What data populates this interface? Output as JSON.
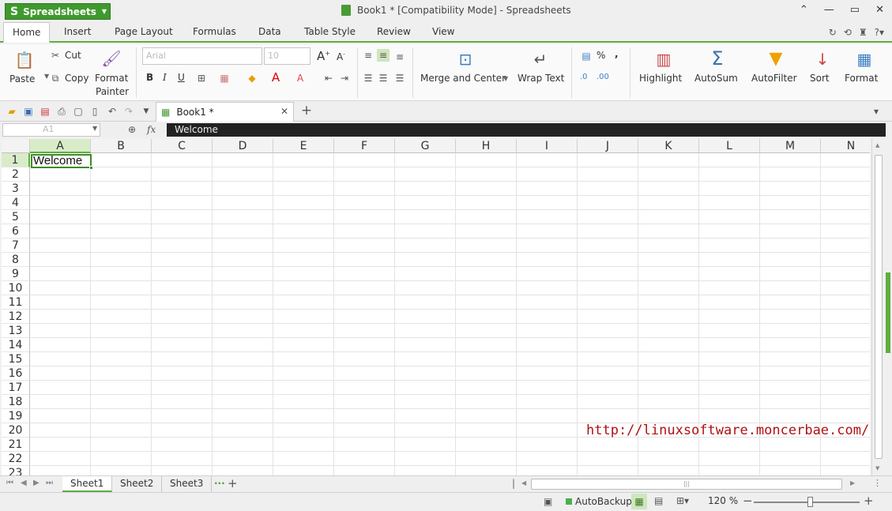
{
  "app": {
    "name": "Spreadsheets",
    "window_title": "Book1 * [Compatibility Mode] - Spreadsheets"
  },
  "menu": {
    "items": [
      "Home",
      "Insert",
      "Page Layout",
      "Formulas",
      "Data",
      "Table Style",
      "Review",
      "View"
    ],
    "active": "Home"
  },
  "ribbon": {
    "paste": "Paste",
    "cut": "Cut",
    "copy": "Copy",
    "format_painter_1": "Format",
    "format_painter_2": "Painter",
    "merge_center": "Merge and Center",
    "wrap_text": "Wrap Text",
    "percent": "%",
    "comma": ",",
    "highlight": "Highlight",
    "autosum": "AutoSum",
    "autofilter": "AutoFilter",
    "sort": "Sort",
    "format": "Format",
    "bold": "B",
    "italic": "I",
    "underline": "U",
    "font_name": "Arial",
    "font_size": "10"
  },
  "doc_tab": {
    "label": "Book1 *"
  },
  "formula_bar": {
    "name_box": "A1",
    "fx": "fx",
    "content": "Welcome"
  },
  "grid": {
    "columns": [
      "A",
      "B",
      "C",
      "D",
      "E",
      "F",
      "G",
      "H",
      "I",
      "J",
      "K",
      "L",
      "M",
      "N"
    ],
    "rows": [
      "1",
      "2",
      "3",
      "4",
      "5",
      "6",
      "7",
      "8",
      "9",
      "10",
      "11",
      "12",
      "13",
      "14",
      "15",
      "16",
      "17",
      "18",
      "19",
      "20",
      "21",
      "22",
      "23"
    ],
    "selected_cell": "A1",
    "cells": {
      "A1": "Welcome"
    }
  },
  "watermark": "http://linuxsoftware.moncerbae.com/",
  "sheets": {
    "tabs": [
      "Sheet1",
      "Sheet2",
      "Sheet3"
    ],
    "active": "Sheet1",
    "more": "···",
    "add": "+"
  },
  "status": {
    "autobackup": "AutoBackup",
    "zoom": "120 %",
    "zoom_level": 0.53
  }
}
